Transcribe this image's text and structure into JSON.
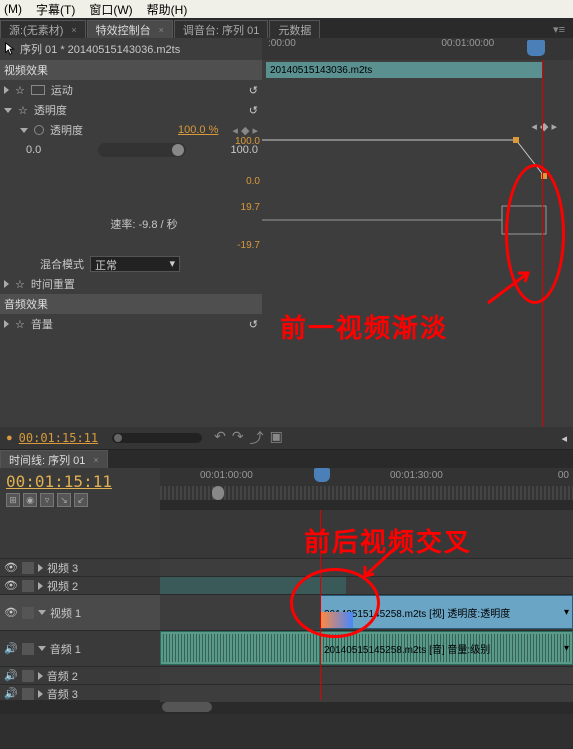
{
  "menubar": {
    "m": "(M)",
    "subtitle": "字幕(T)",
    "window": "窗口(W)",
    "help": "帮助(H)"
  },
  "tabs": {
    "source": "源:(无素材)",
    "fx": "特效控制台",
    "mixer": "调音台: 序列 01",
    "meta": "元数据"
  },
  "fx": {
    "clipTitle": "序列 01 * 20140515143036.m2ts",
    "rulerLeft": ":00:00",
    "rulerMid": "00:01:00:00",
    "clipName": "20140515143036.m2ts",
    "videoFx": "视频效果",
    "motion": "运动",
    "opacity": "透明度",
    "opacityParam": "透明度",
    "opacityVal": "100.0 %",
    "p0": "0.0",
    "p100": "100.0",
    "gl100": "100.0",
    "gl0": "0.0",
    "gl197p": "19.7",
    "gl197n": "-19.7",
    "rateLabel": "速率: -9.8 / 秒",
    "blendLabel": "混合模式",
    "blendVal": "正常",
    "timeRemap": "时间重置",
    "audioFx": "音频效果",
    "volume": "音量",
    "timecode": "00:01:15:11"
  },
  "anno1": "前一视频渐淡",
  "anno2": "前后视频交叉",
  "timeline": {
    "tabLabel": "时间线: 序列 01",
    "timecode": "00:01:15:11",
    "r1": "00:01:00:00",
    "r2": "00:01:30:00",
    "r3": "00",
    "v3": "视频 3",
    "v2": "视频 2",
    "v1": "视频 1",
    "a1": "音频 1",
    "a2": "音频 2",
    "a3": "音频 3",
    "clipV": "20140515145258.m2ts [视] 透明度:透明度",
    "clipA": "20140515145258.m2ts [音] 音量:级别"
  }
}
